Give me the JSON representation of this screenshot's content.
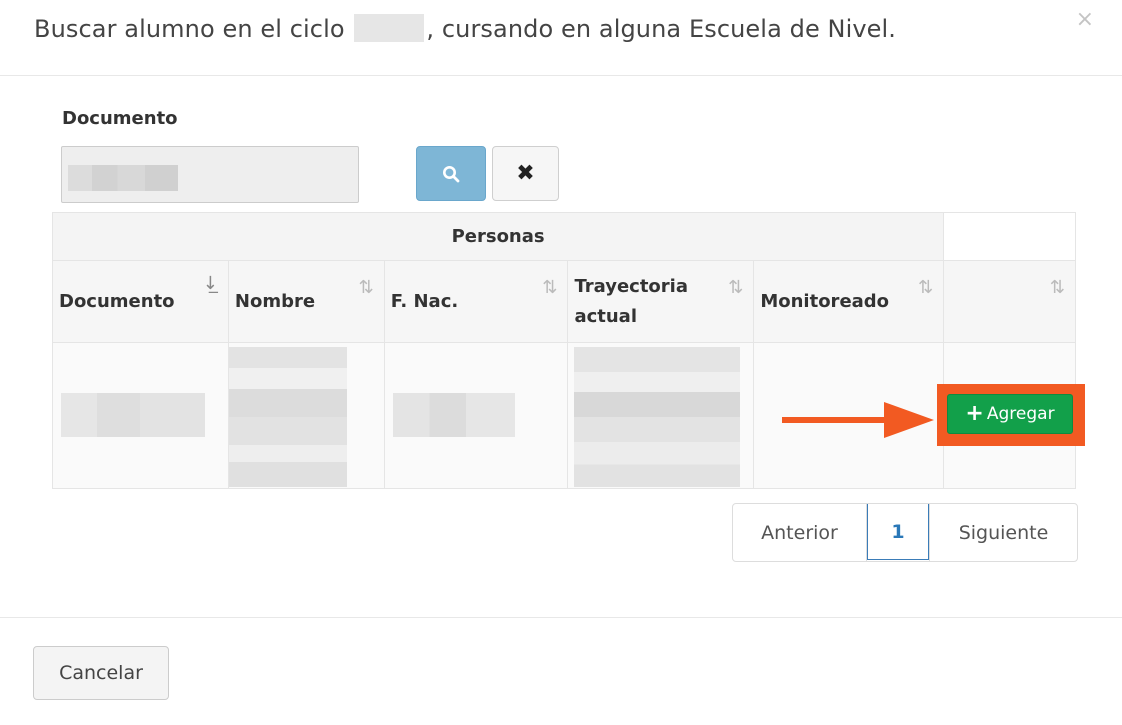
{
  "modal": {
    "title_prefix": "Buscar alumno en el ciclo",
    "title_suffix": ", cursando en alguna Escuela de Nivel.",
    "close_symbol": "×"
  },
  "search": {
    "label": "Documento",
    "search_icon": "search-icon",
    "clear_icon": "close-icon",
    "clear_symbol": "✖"
  },
  "table": {
    "group_header": "Personas",
    "columns": [
      {
        "label": "Documento",
        "sort": "sort-asc"
      },
      {
        "label": "Nombre",
        "sort": "sort"
      },
      {
        "label": "F. Nac.",
        "sort": "sort"
      },
      {
        "label": "Trayectoria actual",
        "sort": "sort"
      },
      {
        "label": "Monitoreado",
        "sort": "sort"
      },
      {
        "label": "",
        "sort": "sort"
      }
    ],
    "sort_symbol": "⇅",
    "add_button": {
      "icon": "+",
      "label": "Agregar"
    }
  },
  "pagination": {
    "prev": "Anterior",
    "current": "1",
    "next": "Siguiente"
  },
  "footer": {
    "cancel": "Cancelar"
  },
  "colors": {
    "add_button": "#12a04a",
    "highlight": "#f25a22",
    "search_button": "#7eb6d6"
  }
}
